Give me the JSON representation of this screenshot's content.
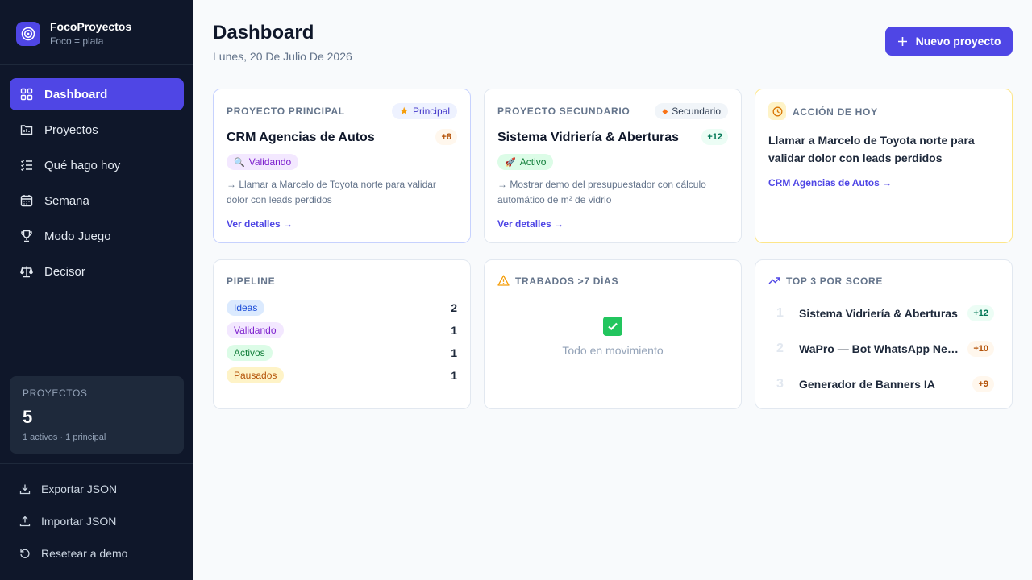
{
  "brand": {
    "name": "FocoProyectos",
    "tagline": "Foco = plata"
  },
  "nav": {
    "items": [
      {
        "label": "Dashboard",
        "icon": "grid-icon"
      },
      {
        "label": "Proyectos",
        "icon": "folder-chart-icon"
      },
      {
        "label": "Qué hago hoy",
        "icon": "list-check-icon"
      },
      {
        "label": "Semana",
        "icon": "calendar-icon"
      },
      {
        "label": "Modo Juego",
        "icon": "trophy-icon"
      },
      {
        "label": "Decisor",
        "icon": "scale-icon"
      }
    ]
  },
  "stats": {
    "title": "PROYECTOS",
    "count": "5",
    "subtitle": "1 activos · 1 principal"
  },
  "footer": {
    "export": "Exportar JSON",
    "import": "Importar JSON",
    "reset": "Resetear a demo"
  },
  "header": {
    "title": "Dashboard",
    "date": "Lunes, 20 De Julio De 2026",
    "new_button": "Nuevo proyecto"
  },
  "principal": {
    "label": "PROYECTO PRINCIPAL",
    "badge": "Principal",
    "name": "CRM Agencias de Autos",
    "score": "+8",
    "status": "Validando",
    "description": "→ Llamar a Marcelo de Toyota norte para validar dolor con leads perdidos",
    "details": "Ver detalles"
  },
  "secundario": {
    "label": "PROYECTO SECUNDARIO",
    "badge": "Secundario",
    "name": "Sistema Vidriería & Aberturas",
    "score": "+12",
    "status": "Activo",
    "description": "→ Mostrar demo del presupuestador con cálculo automático de m² de vidrio",
    "details": "Ver detalles"
  },
  "accion": {
    "label": "ACCIÓN DE HOY",
    "text": "Llamar a Marcelo de Toyota norte para validar dolor con leads perdidos",
    "project_link": "CRM Agencias de Autos"
  },
  "pipeline": {
    "label": "PIPELINE",
    "rows": [
      {
        "label": "Ideas",
        "count": "2",
        "bg": "#dbeafe",
        "fg": "#1d4ed8"
      },
      {
        "label": "Validando",
        "count": "1",
        "bg": "#f3e8ff",
        "fg": "#7e22ce"
      },
      {
        "label": "Activos",
        "count": "1",
        "bg": "#dcfce7",
        "fg": "#15803d"
      },
      {
        "label": "Pausados",
        "count": "1",
        "bg": "#fef3c7",
        "fg": "#b45309"
      }
    ]
  },
  "trabados": {
    "label": "TRABADOS >7 DÍAS",
    "empty_text": "Todo en movimiento"
  },
  "top3": {
    "label": "TOP 3 POR SCORE",
    "rows": [
      {
        "rank": "1",
        "name": "Sistema Vidriería & Aberturas",
        "score": "+12",
        "color": "green"
      },
      {
        "rank": "2",
        "name": "WaPro — Bot WhatsApp Negocios",
        "score": "+10",
        "color": "orange"
      },
      {
        "rank": "3",
        "name": "Generador de Banners IA",
        "score": "+9",
        "color": "orange"
      }
    ]
  },
  "colors": {
    "accent": "#4f46e5",
    "sidebar": "#0f172a",
    "warning": "#f59e0b",
    "success": "#22c55e"
  }
}
